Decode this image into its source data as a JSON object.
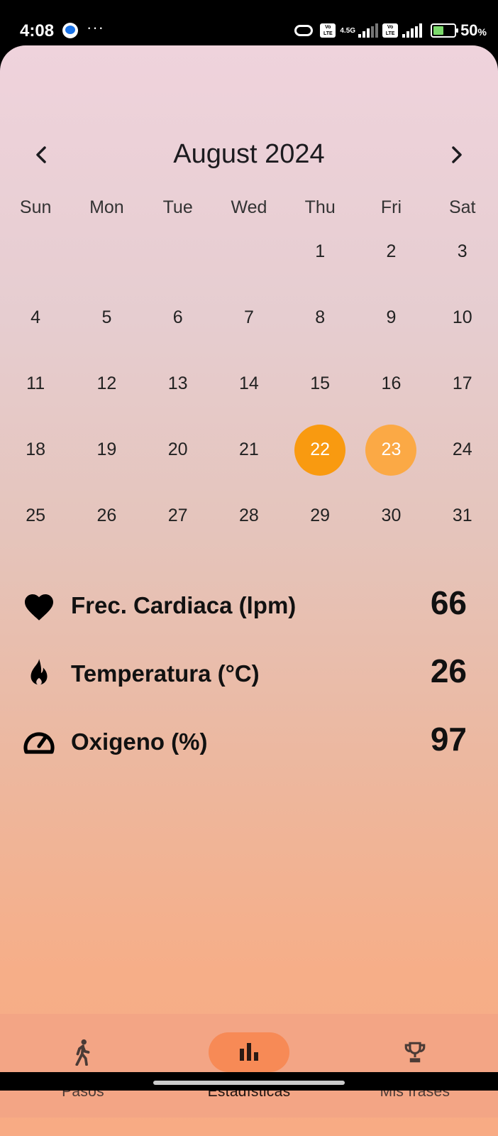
{
  "status_bar": {
    "time": "4:08",
    "dots": "···",
    "network_label": "4.5G",
    "volte_label": "Vo LTE",
    "battery_percent": "50",
    "battery_unit": "%",
    "icons": [
      "messenger-icon",
      "link-icon",
      "volte-icon",
      "signal-icon",
      "battery-charging-icon"
    ]
  },
  "calendar": {
    "month_title": "August 2024",
    "prev_icon": "chevron-left-icon",
    "next_icon": "chevron-right-icon",
    "weekdays": [
      "Sun",
      "Mon",
      "Tue",
      "Wed",
      "Thu",
      "Fri",
      "Sat"
    ],
    "days": [
      "",
      "",
      "",
      "",
      "1",
      "2",
      "3",
      "4",
      "5",
      "6",
      "7",
      "8",
      "9",
      "10",
      "11",
      "12",
      "13",
      "14",
      "15",
      "16",
      "17",
      "18",
      "19",
      "20",
      "21",
      "22",
      "23",
      "24",
      "25",
      "26",
      "27",
      "28",
      "29",
      "30",
      "31"
    ],
    "selected_days": [
      "22",
      "23"
    ],
    "selected_colors": [
      "#f99a10",
      "#fba945"
    ]
  },
  "stats": [
    {
      "icon": "heart-icon",
      "label": "Frec. Cardiaca (lpm)",
      "value": "66"
    },
    {
      "icon": "fire-icon",
      "label": "Temperatura (°C)",
      "value": "26"
    },
    {
      "icon": "speedometer-icon",
      "label": "Oxigeno (%)",
      "value": "97"
    }
  ],
  "bottom_nav": {
    "items": [
      {
        "icon": "walking-person-icon",
        "label": "Pasos",
        "active": false
      },
      {
        "icon": "bar-chart-icon",
        "label": "Estadísticas",
        "active": true
      },
      {
        "icon": "trophy-icon",
        "label": "Mis frases",
        "active": false
      }
    ],
    "accent_color": "#f78a56"
  }
}
